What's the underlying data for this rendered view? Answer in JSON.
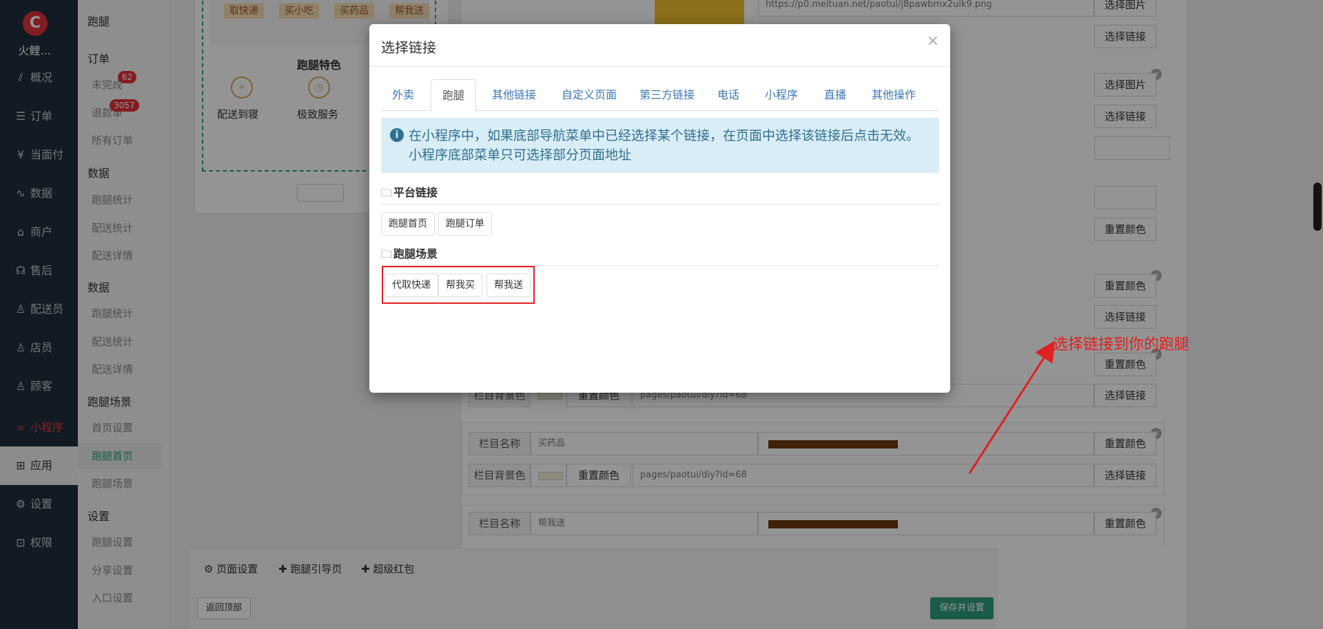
{
  "nav": {
    "brand": "火鲤...",
    "items": [
      {
        "label": "概况",
        "icon": "chart-line-icon"
      },
      {
        "label": "订单",
        "icon": "list-icon"
      },
      {
        "label": "当面付",
        "icon": "yen-icon"
      },
      {
        "label": "数据",
        "icon": "pulse-icon"
      },
      {
        "label": "商户",
        "icon": "store-icon"
      },
      {
        "label": "售后",
        "icon": "headset-icon"
      },
      {
        "label": "配送员",
        "icon": "user-icon"
      },
      {
        "label": "店员",
        "icon": "user-icon"
      },
      {
        "label": "顾客",
        "icon": "user-icon"
      },
      {
        "label": "小程序",
        "icon": "link-icon"
      },
      {
        "label": "应用",
        "icon": "apps-icon"
      },
      {
        "label": "设置",
        "icon": "gear-icon"
      },
      {
        "label": "权限",
        "icon": "lock-icon"
      }
    ]
  },
  "sub": {
    "top": "跑腿",
    "h_order": "订单",
    "unfinished": "未完成",
    "unfinished_badge": "62",
    "refund": "退款单",
    "refund_badge": "3057",
    "all_orders": "所有订单",
    "h_data1": "数据",
    "run_stats1": "跑腿统计",
    "deliver_stats1": "配送统计",
    "deliver_detail1": "配送详情",
    "h_data2": "数据",
    "run_stats2": "跑腿统计",
    "deliver_stats2": "配送统计",
    "deliver_detail2": "配送详情",
    "h_scene": "跑腿场景",
    "home_setting": "首页设置",
    "run_home": "跑腿首页",
    "run_scene": "跑腿场景",
    "h_setting": "设置",
    "run_setting": "跑腿设置",
    "share_setting": "分享设置",
    "entry_setting": "入口设置"
  },
  "preview": {
    "tags": [
      "取快递",
      "买小吃",
      "买药品",
      "帮我送"
    ],
    "features_title": "跑腿特色",
    "feature1": "配送到寝",
    "feature2": "极致服务"
  },
  "editor": {
    "img_url": "https://p0.meituan.net/paotui/j8pawbmx2uik9.png",
    "choose_image": "选择图片",
    "choose_link": "选择链接",
    "reset_color": "重置颜色",
    "bg_label": "栏目背景色",
    "name_label": "栏目名称",
    "link_path": "pages/paotui/diy?id=68",
    "item_buy_medicine": "买药品",
    "item_help_send": "帮我送"
  },
  "bottom": {
    "page_setting": "页面设置",
    "run_guide": "跑腿引导页",
    "super_redpacket": "超级红包",
    "back_top": "返回顶部",
    "save": "保存并设置"
  },
  "modal": {
    "title": "选择链接",
    "close": "×",
    "tabs": [
      "外卖",
      "跑腿",
      "其他链接",
      "自定义页面",
      "第三方链接",
      "电话",
      "小程序",
      "直播",
      "其他操作"
    ],
    "active_tab": "跑腿",
    "info": "在小程序中，如果底部导航菜单中已经选择某个链接，在页面中选择该链接后点击无效。 小程序底部菜单只可选择部分页面地址",
    "section1": "平台链接",
    "links1": [
      "跑腿首页",
      "跑腿订单"
    ],
    "section2": "跑腿场景",
    "links2": [
      "代取快递",
      "帮我买",
      "帮我送"
    ]
  },
  "annotation": "选择链接到你的跑腿",
  "colors": {
    "accent_red": "#e02020",
    "nav_bg": "#1f2d3d",
    "save_green": "#2e9e7e"
  }
}
